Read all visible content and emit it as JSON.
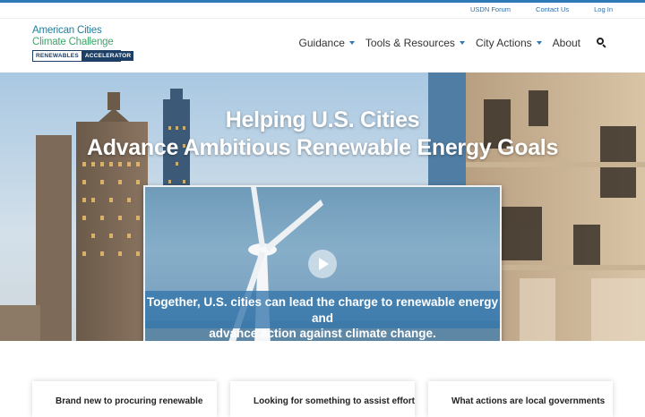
{
  "utility_nav": [
    "USDN Forum",
    "Contact Us",
    "Log In"
  ],
  "logo": {
    "line1": "American Cities",
    "line2": "Climate Challenge",
    "badge_left": "RENEWABLES",
    "badge_right": "ACCELERATOR"
  },
  "main_nav": [
    {
      "label": "Guidance",
      "dropdown": true
    },
    {
      "label": "Tools & Resources",
      "dropdown": true
    },
    {
      "label": "City Actions",
      "dropdown": true
    },
    {
      "label": "About",
      "dropdown": false
    }
  ],
  "hero": {
    "title_line1": "Helping U.S. Cities",
    "title_line2": "Advance Ambitious Renewable Energy Goals",
    "video_caption_line1": "Together, U.S. cities can lead the charge to renewable energy and",
    "video_caption_line2": "advance action against climate change."
  },
  "cards": [
    "Brand new to procuring renewable",
    "Looking for something to assist efforts",
    "What actions are local governments"
  ],
  "colors": {
    "accent": "#2f79b8",
    "brand_navy": "#1d3f66",
    "brand_green": "#3aa86a"
  }
}
